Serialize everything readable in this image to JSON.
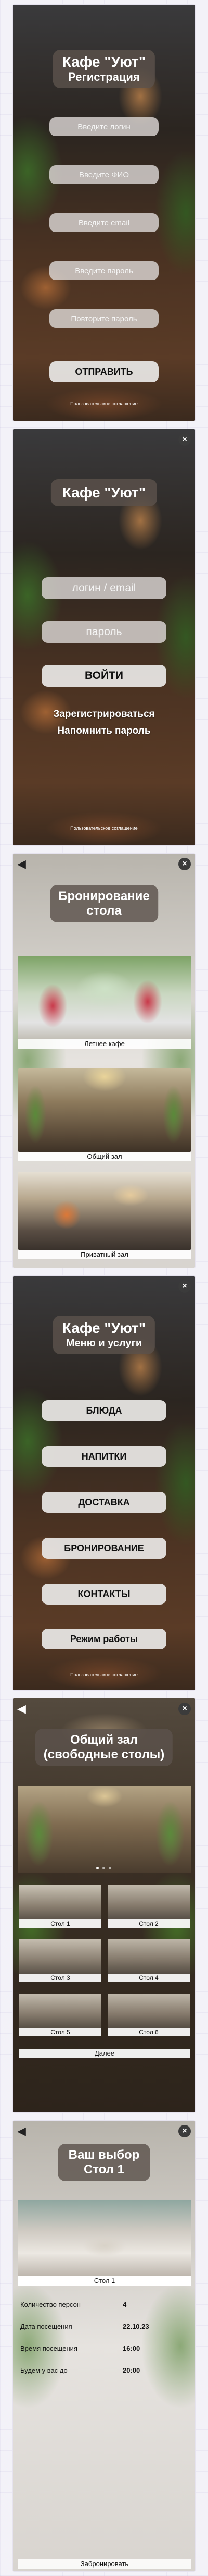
{
  "screen1": {
    "title": "Кафе \"Уют\"",
    "subtitle": "Регистрация",
    "fields": [
      {
        "placeholder": "Введите логин"
      },
      {
        "placeholder": "Введите ФИО"
      },
      {
        "placeholder": "Введите email"
      },
      {
        "placeholder": "Введите пароль"
      },
      {
        "placeholder": "Повторите пароль"
      }
    ],
    "submit_label": "ОТПРАВИТЬ",
    "agreement": "Пользовательское соглашение"
  },
  "screen2": {
    "close_icon": "×",
    "title": "Кафе \"Уют\"",
    "login_placeholder": "логин / email",
    "password_placeholder": "пароль",
    "login_button": "ВОЙТИ",
    "register_link": "Зарегистрироваться",
    "remind_link": "Напомнить пароль",
    "agreement": "Пользовательское соглашение"
  },
  "screen3": {
    "back_icon": "◀",
    "close_icon": "×",
    "title_line1": "Бронирование",
    "title_line2": "стола",
    "halls": [
      {
        "label": "Летнее кафе"
      },
      {
        "label": "Общий зал"
      },
      {
        "label": "Приватный зал"
      }
    ]
  },
  "screen4": {
    "close_icon": "×",
    "title": "Кафе \"Уют\"",
    "subtitle": "Меню и услуги",
    "menu": [
      "БЛЮДА",
      "НАПИТКИ",
      "ДОСТАВКА",
      "БРОНИРОВАНИЕ",
      "КОНТАКТЫ",
      "Режим работы"
    ],
    "agreement": "Пользовательское соглашение"
  },
  "screen5": {
    "back_icon": "◀",
    "close_icon": "×",
    "title_line1": "Общий зал",
    "title_line2": "(свободные столы)",
    "tables": [
      "Стол 1",
      "Стол 2",
      "Стол 3",
      "Стол 4",
      "Стол 5",
      "Стол 6"
    ],
    "next_label": "Далее"
  },
  "screen6": {
    "back_icon": "◀",
    "close_icon": "×",
    "title_line1": "Ваш выбор",
    "title_line2": "Стол 1",
    "photo_caption": "Стол 1",
    "rows": [
      {
        "label": "Количество персон",
        "value": "4"
      },
      {
        "label": "Дата посещения",
        "value": "22.10.23"
      },
      {
        "label": "Время посещения",
        "value": "16:00"
      },
      {
        "label": "Будем у вас до",
        "value": "20:00"
      }
    ],
    "submit_label": "Забронировать"
  }
}
